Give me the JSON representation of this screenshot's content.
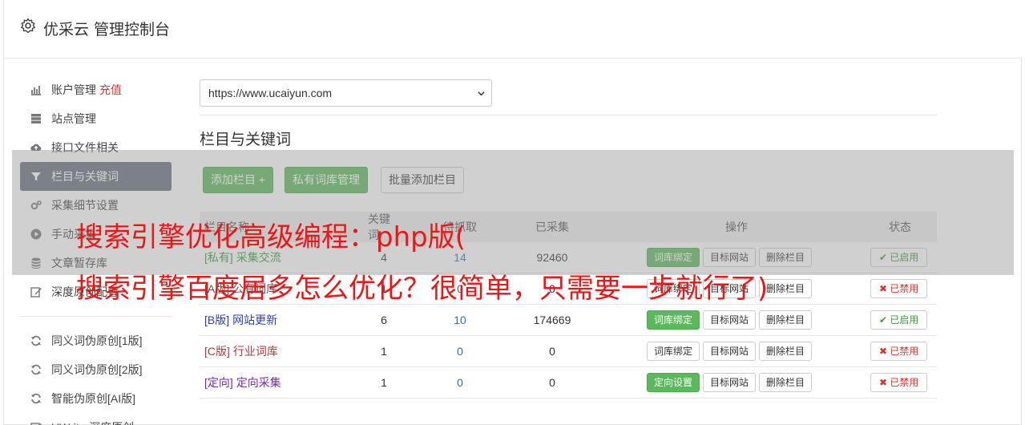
{
  "header": {
    "title": "优采云 管理控制台"
  },
  "sidebar": {
    "items": [
      {
        "label": "账户管理",
        "extra": "充值",
        "icon": "bar-chart-icon"
      },
      {
        "label": "站点管理",
        "icon": "server-icon"
      },
      {
        "label": "接口文件相关",
        "icon": "cloud-upload-icon"
      },
      {
        "label": "栏目与关键词",
        "icon": "filter-icon",
        "active": true
      },
      {
        "label": "采集细节设置",
        "icon": "cogs-icon"
      },
      {
        "label": "手动采集",
        "icon": "play-circle-icon"
      },
      {
        "label": "文章暂存库",
        "icon": "database-icon"
      },
      {
        "label": "深度原创配置",
        "icon": "edit-icon"
      }
    ],
    "tools": [
      {
        "label": "同义词伪原创[1版]",
        "icon": "refresh-icon"
      },
      {
        "label": "同义词伪原创[2版]",
        "icon": "refresh-icon"
      },
      {
        "label": "智能伪原创[AI版]",
        "icon": "refresh-icon"
      },
      {
        "label": "UWriter深度原创",
        "icon": "edit-icon"
      }
    ]
  },
  "site_select": {
    "value": "https://www.ucaiyun.com"
  },
  "section": {
    "title": "栏目与关键词"
  },
  "toolbar": {
    "add_column": "添加栏目 +",
    "private_lib": "私有词库管理",
    "batch_add": "批量添加栏目"
  },
  "table": {
    "headers": {
      "name": "栏目名称",
      "keywords": "关键词",
      "pending": "待抓取",
      "done": "已采集",
      "ops": "操作",
      "state": "状态"
    },
    "rows": [
      {
        "tag": "[私有]",
        "name": "采集交流",
        "tag_color": "#3c9a3c",
        "keywords": "4",
        "pending": "14",
        "done": "92460",
        "op1": "词库绑定",
        "op1_green": true,
        "op2": "目标网站",
        "op3": "删除栏目",
        "state": "已启用",
        "enabled": true
      },
      {
        "tag": "[A版]",
        "name": "公有词库",
        "tag_color": "#555555",
        "keywords": "1",
        "pending": "0",
        "done": "0",
        "op1": "词库绑定",
        "op1_green": false,
        "op2": "目标网站",
        "op3": "删除栏目",
        "state": "已禁用",
        "enabled": false
      },
      {
        "tag": "[B版]",
        "name": "网站更新",
        "tag_color": "#2a3ec4",
        "keywords": "6",
        "pending": "10",
        "done": "174669",
        "op1": "词库绑定",
        "op1_green": true,
        "op2": "目标网站",
        "op3": "删除栏目",
        "state": "已启用",
        "enabled": true
      },
      {
        "tag": "[C版]",
        "name": "行业词库",
        "tag_color": "#b03a3a",
        "keywords": "1",
        "pending": "0",
        "done": "0",
        "op1": "词库绑定",
        "op1_green": false,
        "op2": "目标网站",
        "op3": "删除栏目",
        "state": "已禁用",
        "enabled": false
      },
      {
        "tag": "[定向]",
        "name": "定向采集",
        "tag_color": "#7a2aa8",
        "keywords": "1",
        "pending": "0",
        "done": "0",
        "op1": "定向设置",
        "op1_green": true,
        "op2": "目标网站",
        "op3": "删除栏目",
        "state": "已禁用",
        "enabled": false
      }
    ]
  },
  "watermark": {
    "line1": "搜索引擎优化高级编程：php版(",
    "line2": "搜索引擎百度居多怎么优化？很简单，只需要一步就行了)"
  }
}
